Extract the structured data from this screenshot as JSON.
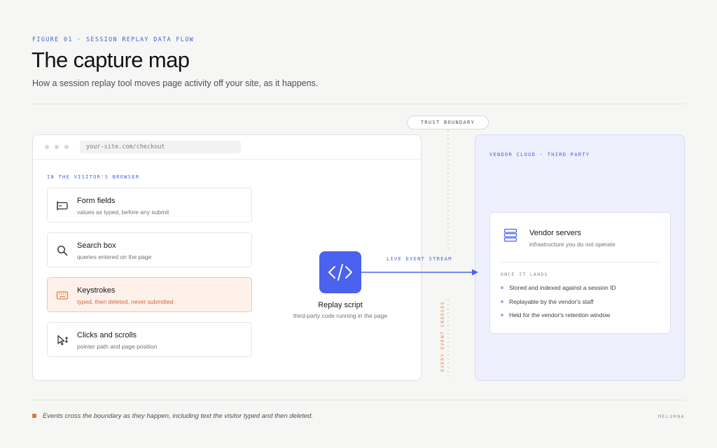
{
  "header": {
    "eyebrow": "FIGURE 01 · SESSION REPLAY DATA FLOW",
    "title": "The capture map",
    "subtitle": "How a session replay tool moves page activity off your site, as it happens."
  },
  "boundary": {
    "label": "TRUST BOUNDARY",
    "vertical_text": "EVERY EVENT CROSSES"
  },
  "browser": {
    "url": "your-site.com/checkout",
    "label": "IN THE VISITOR'S BROWSER",
    "items": [
      {
        "title": "Form fields",
        "sub": "values as typed, before any submit",
        "icon": "form-field-icon"
      },
      {
        "title": "Search box",
        "sub": "queries entered on the page",
        "icon": "search-icon"
      },
      {
        "title": "Keystrokes",
        "sub": "typed, then deleted, never submitted",
        "icon": "keyboard-icon"
      },
      {
        "title": "Clicks and scrolls",
        "sub": "pointer path and page position",
        "icon": "pointer-icon"
      }
    ]
  },
  "script": {
    "title": "Replay script",
    "sub": "third-party code running in the page",
    "icon": "code-icon"
  },
  "stream": {
    "label": "LIVE EVENT STREAM"
  },
  "vendor": {
    "label": "VENDOR CLOUD · THIRD PARTY",
    "card_title": "Vendor servers",
    "card_sub": "infrastructure you do not operate",
    "card_label": "ONCE IT LANDS",
    "bullets": [
      "Stored and indexed against a session ID",
      "Replayable by the vendor's staff",
      "Held for the vendor's retention window"
    ],
    "icon": "server-icon"
  },
  "footer": {
    "note": "Events cross the boundary as they happen, including text the visitor typed and then deleted.",
    "brand": "MELURNA"
  },
  "colors": {
    "accent": "#4a62ee",
    "highlight": "#e07a43",
    "vendor_bg": "#eef0fd"
  }
}
